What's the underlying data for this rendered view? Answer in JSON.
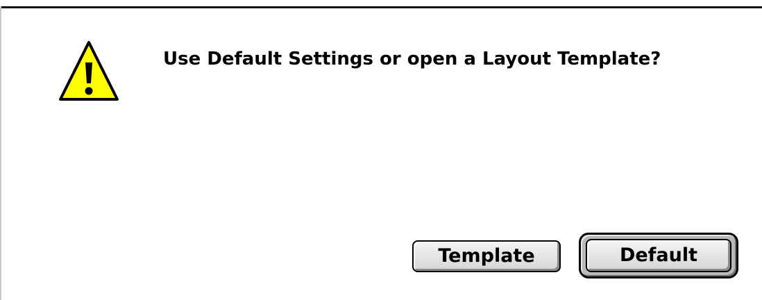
{
  "dialog": {
    "message": "Use Default Settings or open a Layout Template?",
    "icon": "warning-icon",
    "colors": {
      "icon_fill": "#ffff00",
      "icon_stroke": "#000000",
      "button_face": "#dcdcdc"
    }
  },
  "buttons": {
    "template_label": "Template",
    "default_label": "Default",
    "default_button": "Default"
  }
}
